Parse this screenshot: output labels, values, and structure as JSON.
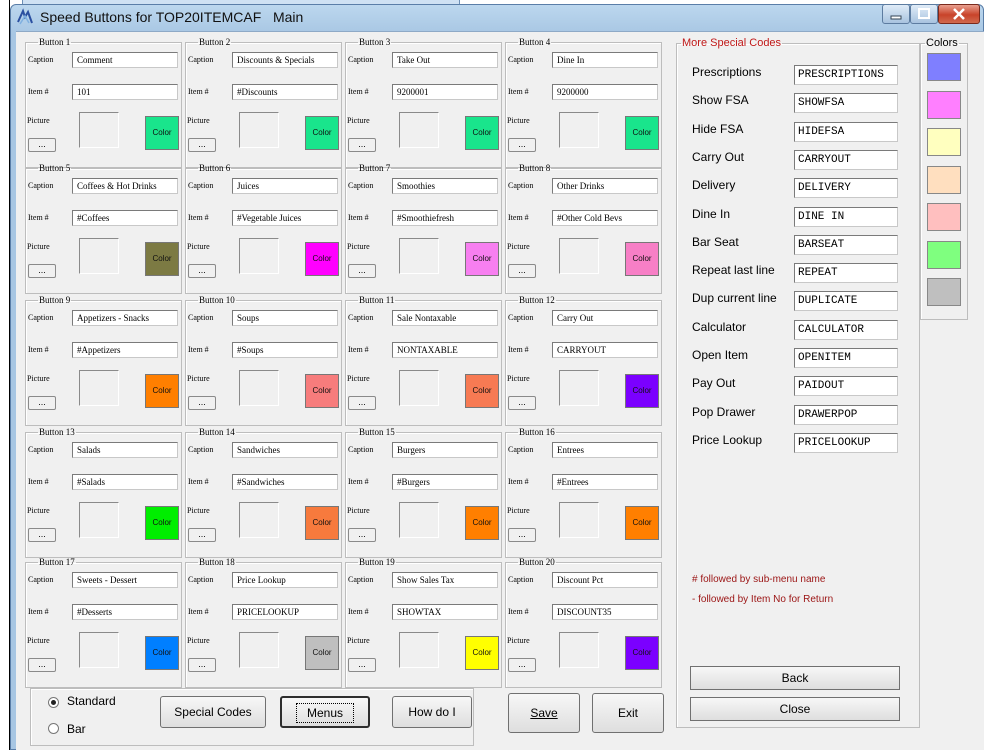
{
  "window": {
    "title": "Speed Buttons for TOP20ITEMCAF",
    "menu": "Main"
  },
  "labels": {
    "caption": "Caption",
    "item": "Item #",
    "picture": "Picture",
    "ellipsis": "...",
    "color": "Color"
  },
  "buttons": [
    {
      "legend": "Button 1",
      "caption": "Comment",
      "item": "101",
      "color": "#19e58c"
    },
    {
      "legend": "Button 2",
      "caption": "Discounts & Specials",
      "item": "#Discounts",
      "color": "#19e58c"
    },
    {
      "legend": "Button 3",
      "caption": "Take Out",
      "item": "9200001",
      "color": "#19e58c"
    },
    {
      "legend": "Button 4",
      "caption": "Dine In",
      "item": "9200000",
      "color": "#19e58c"
    },
    {
      "legend": "Button 5",
      "caption": "Coffees & Hot Drinks",
      "item": "#Coffees",
      "color": "#7c7a43"
    },
    {
      "legend": "Button 6",
      "caption": "Juices",
      "item": "#Vegetable Juices",
      "color": "#ff00ff"
    },
    {
      "legend": "Button 7",
      "caption": "Smoothies",
      "item": "#Smoothiefresh",
      "color": "#f77ff0"
    },
    {
      "legend": "Button 8",
      "caption": "Other Drinks",
      "item": "#Other Cold Bevs",
      "color": "#f77fc6"
    },
    {
      "legend": "Button 9",
      "caption": "Appetizers - Snacks",
      "item": "#Appetizers",
      "color": "#ff7f00"
    },
    {
      "legend": "Button 10",
      "caption": "Soups",
      "item": "#Soups",
      "color": "#f77c7c"
    },
    {
      "legend": "Button 11",
      "caption": "Sale Nontaxable",
      "item": "NONTAXABLE",
      "color": "#f77a53"
    },
    {
      "legend": "Button 12",
      "caption": "Carry Out",
      "item": "CARRYOUT",
      "color": "#7b00ff"
    },
    {
      "legend": "Button 13",
      "caption": "Salads",
      "item": "#Salads",
      "color": "#00ee00"
    },
    {
      "legend": "Button 14",
      "caption": "Sandwiches",
      "item": "#Sandwiches",
      "color": "#f77a3d"
    },
    {
      "legend": "Button 15",
      "caption": "Burgers",
      "item": "#Burgers",
      "color": "#ff7f00"
    },
    {
      "legend": "Button 16",
      "caption": "Entrees",
      "item": "#Entrees",
      "color": "#ff7f00"
    },
    {
      "legend": "Button 17",
      "caption": "Sweets - Dessert",
      "item": "#Desserts",
      "color": "#007fff"
    },
    {
      "legend": "Button 18",
      "caption": "Price Lookup",
      "item": "PRICELOOKUP",
      "color": "#bfbfbf"
    },
    {
      "legend": "Button 19",
      "caption": "Show Sales Tax",
      "item": "SHOWTAX",
      "color": "#ffff00"
    },
    {
      "legend": "Button 20",
      "caption": "Discount Pct",
      "item": "DISCOUNT35",
      "color": "#7b00ff"
    }
  ],
  "special": {
    "legend": "More Special Codes",
    "rows": [
      {
        "label": "Prescriptions",
        "value": "PRESCRIPTIONS"
      },
      {
        "label": "Show FSA",
        "value": "SHOWFSA"
      },
      {
        "label": "Hide FSA",
        "value": "HIDEFSA"
      },
      {
        "label": "Carry Out",
        "value": "CARRYOUT"
      },
      {
        "label": "Delivery",
        "value": "DELIVERY"
      },
      {
        "label": "Dine In",
        "value": "DINE IN"
      },
      {
        "label": "Bar Seat",
        "value": "BARSEAT"
      },
      {
        "label": "Repeat last line",
        "value": "REPEAT"
      },
      {
        "label": "Dup current line",
        "value": "DUPLICATE"
      },
      {
        "label": "Calculator",
        "value": "CALCULATOR"
      },
      {
        "label": "Open Item",
        "value": "OPENITEM"
      },
      {
        "label": "Pay Out",
        "value": "PAIDOUT"
      },
      {
        "label": "Pop Drawer",
        "value": "DRAWERPOP"
      },
      {
        "label": "Price Lookup",
        "value": "PRICELOOKUP"
      }
    ],
    "note1": "# followed by sub-menu name",
    "note2": "-  followed by Item No for Return",
    "back": "Back",
    "close": "Close"
  },
  "colors": {
    "legend": "Colors",
    "swatches": [
      "#7f7fff",
      "#ff7fff",
      "#ffffbf",
      "#ffdfbf",
      "#ffbfbf",
      "#7fff7f",
      "#bfbfbf"
    ]
  },
  "mode": {
    "standard": "Standard",
    "bar": "Bar",
    "selected": "Standard"
  },
  "actions": {
    "special_codes": "Special Codes",
    "menus": "Menus",
    "how_do_i": "How do I",
    "save": "Save",
    "exit": "Exit"
  }
}
